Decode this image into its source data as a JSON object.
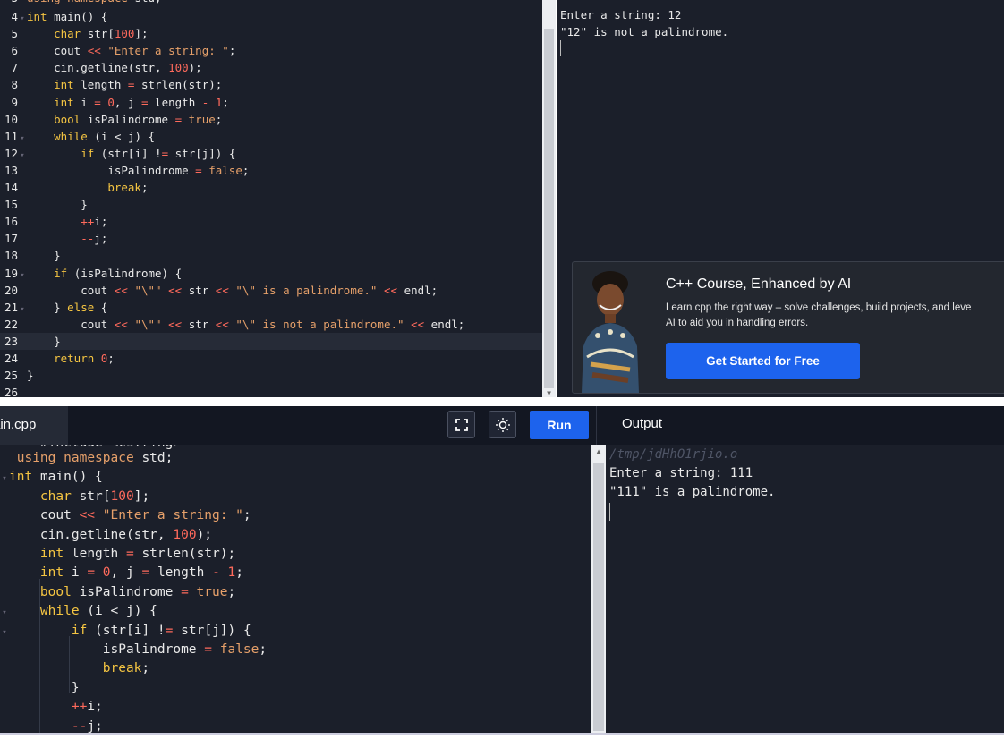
{
  "top_editor": {
    "lines": [
      {
        "n": "3",
        "fold": "",
        "code": "using namespace std;",
        "partial": true
      },
      {
        "n": "4",
        "fold": "▾",
        "code": "int main() {"
      },
      {
        "n": "5",
        "fold": "",
        "code": "    char str[100];"
      },
      {
        "n": "6",
        "fold": "",
        "code": "    cout << \"Enter a string: \";"
      },
      {
        "n": "7",
        "fold": "",
        "code": "    cin.getline(str, 100);"
      },
      {
        "n": "8",
        "fold": "",
        "code": "    int length = strlen(str);"
      },
      {
        "n": "9",
        "fold": "",
        "code": "    int i = 0, j = length - 1;"
      },
      {
        "n": "10",
        "fold": "",
        "code": "    bool isPalindrome = true;"
      },
      {
        "n": "11",
        "fold": "▾",
        "code": "    while (i < j) {"
      },
      {
        "n": "12",
        "fold": "▾",
        "code": "        if (str[i] != str[j]) {"
      },
      {
        "n": "13",
        "fold": "",
        "code": "            isPalindrome = false;"
      },
      {
        "n": "14",
        "fold": "",
        "code": "            break;"
      },
      {
        "n": "15",
        "fold": "",
        "code": "        }"
      },
      {
        "n": "16",
        "fold": "",
        "code": "        ++i;"
      },
      {
        "n": "17",
        "fold": "",
        "code": "        --j;"
      },
      {
        "n": "18",
        "fold": "",
        "code": "    }"
      },
      {
        "n": "19",
        "fold": "▾",
        "code": "    if (isPalindrome) {"
      },
      {
        "n": "20",
        "fold": "",
        "code": "        cout << \"\\\"\" << str << \"\\\" is a palindrome.\" << endl;"
      },
      {
        "n": "21",
        "fold": "▾",
        "code": "    } else {"
      },
      {
        "n": "22",
        "fold": "",
        "code": "        cout << \"\\\"\" << str << \"\\\" is not a palindrome.\" << endl;"
      },
      {
        "n": "23",
        "fold": "",
        "code": "    }",
        "active": true
      },
      {
        "n": "24",
        "fold": "",
        "code": "    return 0;"
      },
      {
        "n": "25",
        "fold": "",
        "code": "}"
      },
      {
        "n": "26",
        "fold": "",
        "code": ""
      }
    ]
  },
  "top_output": {
    "lines": [
      "Enter a string: 12",
      "\"12\" is not a palindrome."
    ]
  },
  "ad": {
    "title": "C++ Course, Enhanced by AI",
    "body": "Learn cpp the right way – solve challenges, build projects, and leve\nAI to aid you in handling errors.",
    "button": "Get Started for Free",
    "avatar_icon": "instructor-photo"
  },
  "toolbar": {
    "file_tab": "ain.cpp",
    "fullscreen_icon": "fullscreen-icon",
    "theme_icon": "sun-icon",
    "run_label": "Run",
    "output_label": "Output"
  },
  "bottom_editor": {
    "lines": [
      {
        "fold": "",
        "code": "    #include <cstring>",
        "partial": true
      },
      {
        "fold": "",
        "code": " using namespace std;"
      },
      {
        "fold": "▾",
        "code": "int main() {"
      },
      {
        "fold": "",
        "code": "    char str[100];"
      },
      {
        "fold": "",
        "code": "    cout << \"Enter a string: \";"
      },
      {
        "fold": "",
        "code": "    cin.getline(str, 100);"
      },
      {
        "fold": "",
        "code": "    int length = strlen(str);"
      },
      {
        "fold": "",
        "code": "    int i = 0, j = length - 1;"
      },
      {
        "fold": "",
        "code": "    bool isPalindrome = true;"
      },
      {
        "fold": "▾",
        "code": "    while (i < j) {"
      },
      {
        "fold": "▾",
        "code": "        if (str[i] != str[j]) {"
      },
      {
        "fold": "",
        "code": "            isPalindrome = false;"
      },
      {
        "fold": "",
        "code": "            break;"
      },
      {
        "fold": "",
        "code": "        }"
      },
      {
        "fold": "",
        "code": "        ++i;"
      },
      {
        "fold": "",
        "code": "        --j;"
      }
    ]
  },
  "bottom_output": {
    "path": "/tmp/jdHhO1rjio.o",
    "lines": [
      "Enter a string: 111",
      "\"111\" is a palindrome."
    ]
  },
  "colors": {
    "editor_bg": "#1b1f2a",
    "keyword": "#f5c542",
    "string": "#e6a06a",
    "number": "#ff6a5c",
    "run_button": "#1d63ed"
  }
}
